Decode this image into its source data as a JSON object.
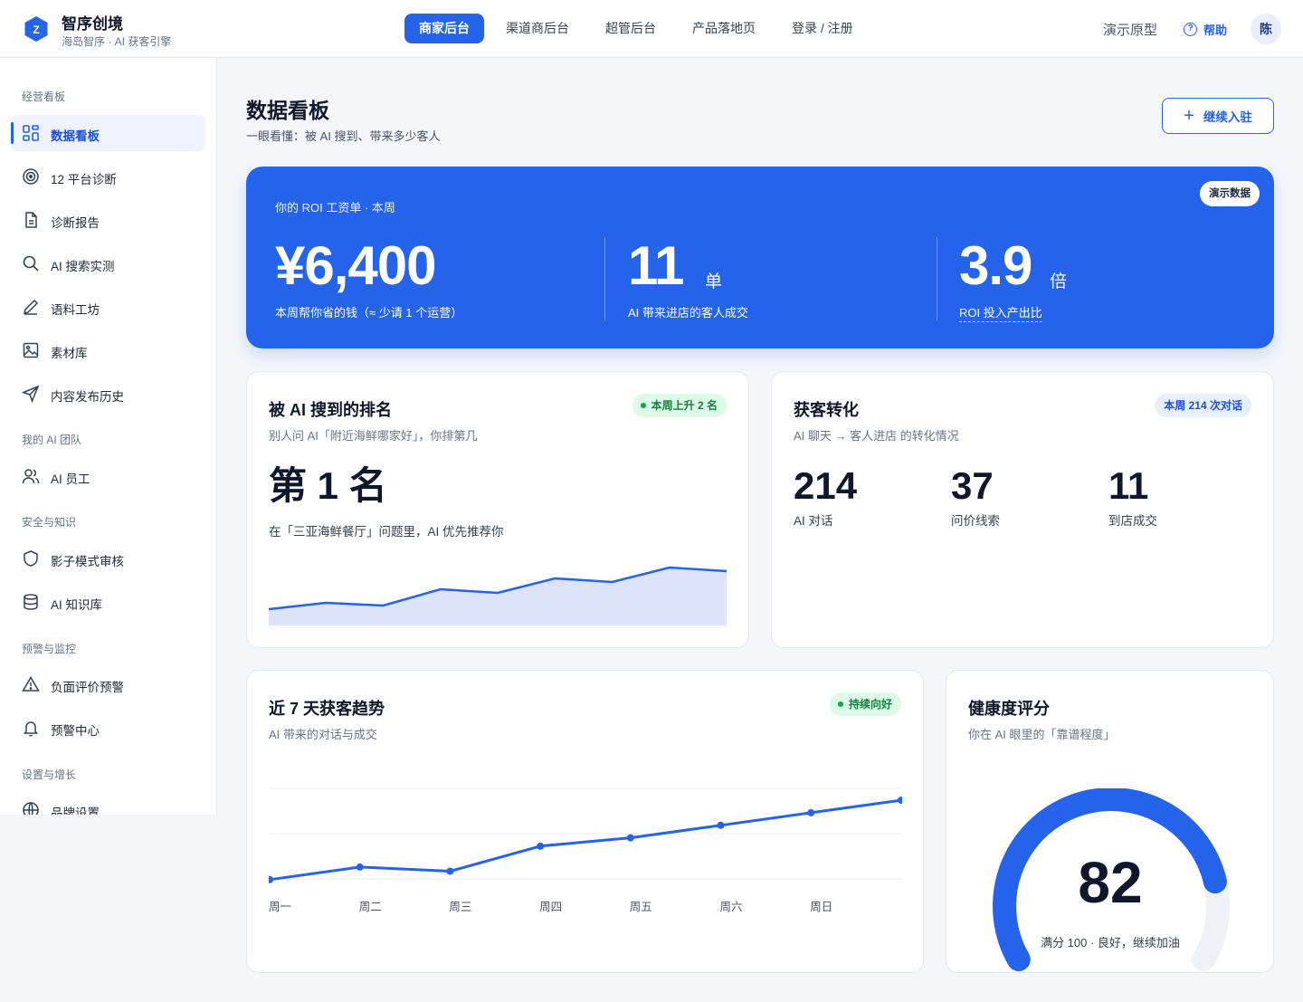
{
  "brand": {
    "title": "智序创境",
    "subtitle": "海岛智序 · AI 获客引擎",
    "logo_letter": "Z"
  },
  "nav": {
    "items": [
      {
        "label": "商家后台",
        "active": true
      },
      {
        "label": "渠道商后台",
        "active": false
      },
      {
        "label": "超管后台",
        "active": false
      },
      {
        "label": "产品落地页",
        "active": false
      },
      {
        "label": "登录 / 注册",
        "active": false
      }
    ],
    "demo_label": "演示原型",
    "help_label": "帮助",
    "avatar": "陈"
  },
  "sidebar": {
    "sections": [
      {
        "title": "经营看板",
        "items": [
          {
            "label": "数据看板",
            "icon": "grid-icon",
            "active": true
          },
          {
            "label": "12 平台诊断",
            "icon": "target-icon"
          },
          {
            "label": "诊断报告",
            "icon": "file-icon"
          },
          {
            "label": "AI 搜索实测",
            "icon": "search-icon"
          },
          {
            "label": "语料工坊",
            "icon": "pen-icon"
          },
          {
            "label": "素材库",
            "icon": "image-icon"
          },
          {
            "label": "内容发布历史",
            "icon": "send-icon"
          }
        ]
      },
      {
        "title": "我的 AI 团队",
        "items": [
          {
            "label": "AI 员工",
            "icon": "users-icon"
          }
        ]
      },
      {
        "title": "安全与知识",
        "items": [
          {
            "label": "影子模式审核",
            "icon": "shield-icon"
          },
          {
            "label": "AI 知识库",
            "icon": "database-icon"
          }
        ]
      },
      {
        "title": "预警与监控",
        "items": [
          {
            "label": "负面评价预警",
            "icon": "warning-icon"
          },
          {
            "label": "预警中心",
            "icon": "bell-icon"
          }
        ]
      },
      {
        "title": "设置与增长",
        "items": [
          {
            "label": "品牌设置",
            "icon": "globe-icon"
          }
        ]
      }
    ]
  },
  "page": {
    "title": "数据看板",
    "subtitle": "一眼看懂：被 AI 搜到、带来多少客人",
    "cta_label": "继续入驻"
  },
  "roi": {
    "title": "你的 ROI 工资单 · 本周",
    "badge": "演示数据",
    "saved_value": "¥6,400",
    "saved_caption": "本周帮你省的钱（≈ 少请 1 个运营）",
    "orders_value": "11",
    "orders_unit": "单",
    "orders_caption": "AI 带来进店的客人成交",
    "ratio_value": "3.9",
    "ratio_unit": "倍",
    "ratio_caption": "ROI 投入产出比"
  },
  "ranking": {
    "title": "被 AI 搜到的排名",
    "subtitle": "别人问 AI「附近海鲜哪家好」，你排第几",
    "badge": "本周上升 2 名",
    "rank_text": "第 1 名",
    "note": "在「三亚海鲜餐厅」问题里，AI 优先推荐你",
    "sparkline": [
      18,
      25,
      22,
      40,
      36,
      52,
      48,
      64,
      60
    ]
  },
  "conversion": {
    "title": "获客转化",
    "subtitle": "AI 聊天 → 客人进店 的转化情况",
    "badge": "本周 214 次对话",
    "stats": [
      {
        "value": "214",
        "label": "AI 对话"
      },
      {
        "value": "37",
        "label": "问价线索"
      },
      {
        "value": "11",
        "label": "到店成交"
      }
    ]
  },
  "trend": {
    "title": "近 7 天获客趋势",
    "subtitle": "AI 带来的对话与成交",
    "badge": "持续向好"
  },
  "chart_data": {
    "type": "line",
    "categories": [
      "周一",
      "周二",
      "周三",
      "周四",
      "周五",
      "周六",
      "周日"
    ],
    "series": [
      {
        "values": [
          10,
          25,
          20,
          50,
          60,
          75,
          90,
          105
        ]
      }
    ],
    "ylim": [
      0,
      130
    ],
    "grid": true
  },
  "health": {
    "title": "健康度评分",
    "subtitle": "你在 AI 眼里的「靠谱程度」",
    "score": "82",
    "score_value": 82,
    "max": 100,
    "caption": "满分 100 · 良好，继续加油"
  },
  "colors": {
    "accent": "#2563eb",
    "positive": "#16a34a",
    "area_fill": "#dbe4fb",
    "track": "#eef2f7"
  }
}
